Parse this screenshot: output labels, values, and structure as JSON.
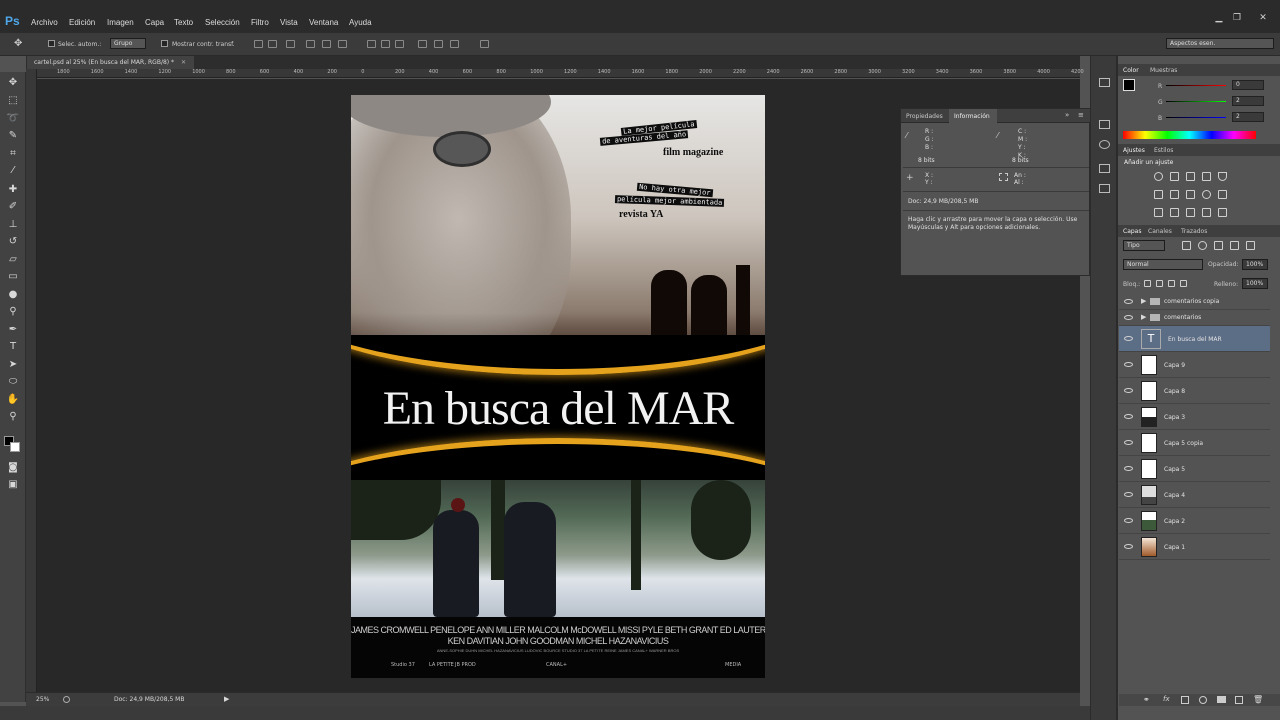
{
  "app": {
    "logo": "Ps"
  },
  "menu": [
    "Archivo",
    "Edición",
    "Imagen",
    "Capa",
    "Texto",
    "Selección",
    "Filtro",
    "Vista",
    "Ventana",
    "Ayuda"
  ],
  "options_bar": {
    "auto_select_label": "Selec. autom.:",
    "auto_select_value": "Grupo",
    "show_transform_label": "Mostrar contr. transf.",
    "workspace": "Aspectos esen."
  },
  "document": {
    "tab_title": "cartel.psd al 25% (En busca del MAR, RGB/8) *",
    "zoom": "25%",
    "doc_size": "Doc: 24,9 MB/208,5 MB"
  },
  "ruler_ticks": [
    "1800",
    "1600",
    "1400",
    "1200",
    "1000",
    "800",
    "600",
    "400",
    "200",
    "0",
    "200",
    "400",
    "600",
    "800",
    "1000",
    "1200",
    "1400",
    "1600",
    "1800",
    "2000",
    "2200",
    "2400",
    "2600",
    "2800",
    "3000",
    "3200",
    "3400",
    "3600",
    "3800",
    "4000",
    "4200"
  ],
  "poster": {
    "title": "En busca del MAR",
    "quote1_line1": "La mejor película",
    "quote1_line2": "de aventuras del año",
    "quote1_source": "film magazine",
    "quote2_line1": "No hay otra mejor",
    "quote2_line2": "película mejor ambientada",
    "quote2_source": "revista YA",
    "cast_line1": "JAMES CROMWELL   PENELOPE ANN MILLER   MALCOLM McDOWELL   MISSI PYLE   BETH GRANT   ED LAUTER   JOEL MURRAY",
    "cast_line2": "KEN DAVITIAN   JOHN GOODMAN   MICHEL HAZANAVICIUS",
    "billing_block": "ANNE-SOPHIE DUHN   MICHEL HAZANAVICIUS   LUDOVIC BOURCE   STUDIO 37   LA PETITE REINE   JAMES CANAL+   WARNER BROS",
    "logos": [
      "Studio 37",
      "LA PETITE",
      "JB PROD",
      "CANAL+",
      "MEDIA"
    ]
  },
  "info_panel": {
    "tabs": [
      "Propiedades",
      "Información"
    ],
    "rgb_labels": [
      "R :",
      "G :",
      "B :"
    ],
    "cmyk_labels": [
      "C :",
      "M :",
      "Y :",
      "K :"
    ],
    "bits_left": "8 bits",
    "bits_right": "8 bits",
    "xy_labels": [
      "X :",
      "Y :"
    ],
    "size_labels": [
      "An :",
      "Al :"
    ],
    "doc": "Doc: 24,9 MB/208,5 MB",
    "hint": "Haga clic y arrastre para mover la capa o selección. Use Mayúsculas y Alt para opciones adicionales."
  },
  "color_panel": {
    "tabs": [
      "Color",
      "Muestras"
    ],
    "r": "0",
    "g": "2",
    "b": "2",
    "r_label": "R",
    "g_label": "G",
    "b_label": "B"
  },
  "adjustments_panel": {
    "tabs": [
      "Ajustes",
      "Estilos"
    ],
    "heading": "Añadir un ajuste"
  },
  "layers_panel": {
    "tabs": [
      "Capas",
      "Canales",
      "Trazados"
    ],
    "kind": "Tipo",
    "blend_mode": "Normal",
    "opacity_label": "Opacidad:",
    "opacity": "100%",
    "lock_label": "Bloq.:",
    "fill_label": "Relleno:",
    "fill": "100%",
    "groups": [
      "comentarios copia",
      "comentarios"
    ],
    "text_layer": "En busca del MAR",
    "layers": [
      "Capa 9",
      "Capa 8",
      "Capa 3",
      "Capa 5 copia",
      "Capa 5",
      "Capa 4",
      "Capa 2",
      "Capa 1"
    ]
  },
  "colors": {
    "accent_selected": "#5c6d86",
    "ps_blue": "#4fa7ea",
    "arc_gold": "#e5a21c"
  }
}
